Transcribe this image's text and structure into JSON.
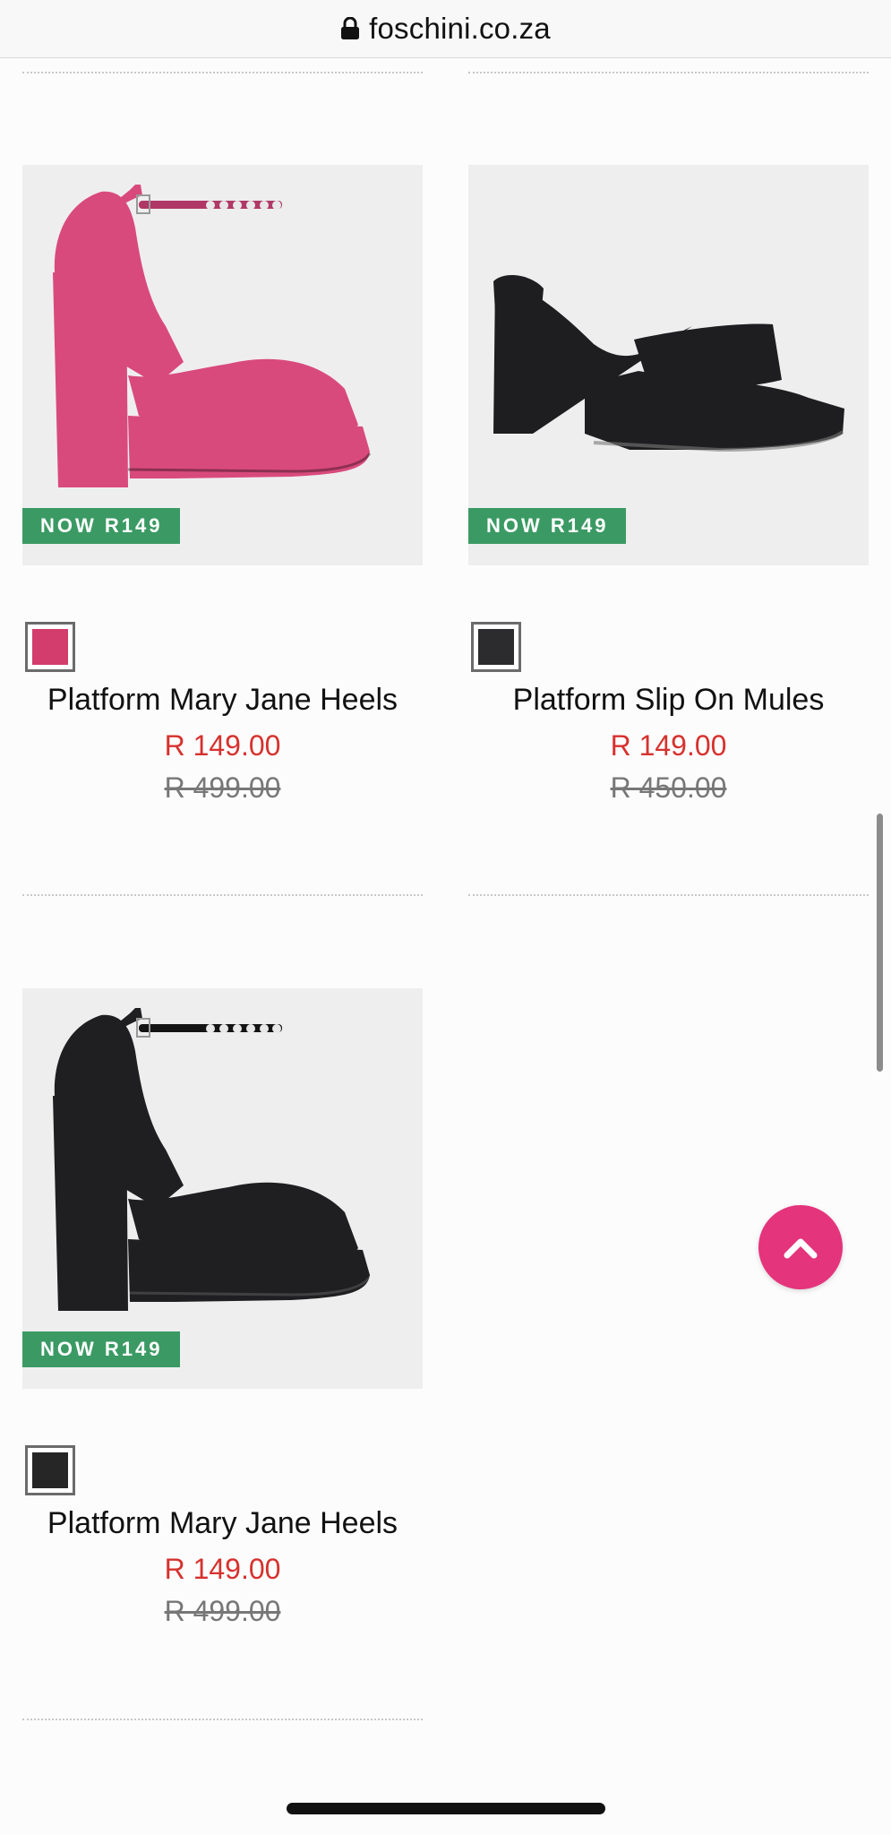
{
  "browser": {
    "domain": "foschini.co.za"
  },
  "products": [
    {
      "badge": "NOW R149",
      "swatch_color": "#d23d6e",
      "name": "Platform Mary Jane Heels",
      "price": "R 149.00",
      "was_price": "R 499.00",
      "shoe_color": "#d94a7c"
    },
    {
      "badge": "NOW R149",
      "swatch_color": "#2c2c2e",
      "name": "Platform Slip On Mules",
      "price": "R 149.00",
      "was_price": "R 450.00",
      "shoe_color": "#1e1e20"
    },
    {
      "badge": "NOW R149",
      "swatch_color": "#262626",
      "name": "Platform Mary Jane Heels",
      "price": "R 149.00",
      "was_price": "R 499.00",
      "shoe_color": "#1f1f21"
    }
  ],
  "colors": {
    "badge_bg": "#3b9a64",
    "sale_price": "#d6322e",
    "scroll_top_button": "#e4347c"
  }
}
